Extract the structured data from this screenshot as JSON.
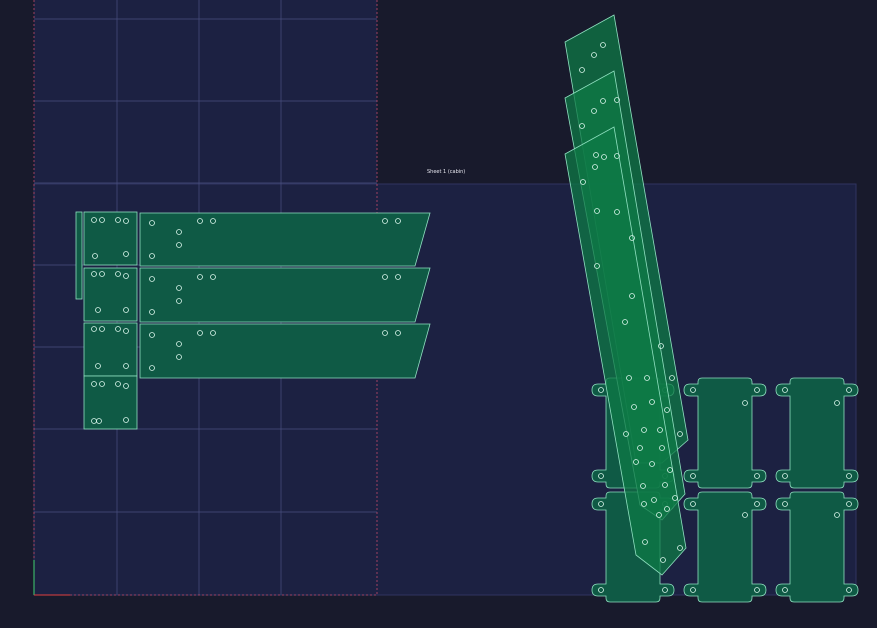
{
  "sheet": {
    "label": "Sheet 1 (cabin)"
  },
  "colors": {
    "background": "#181a2c",
    "sheet_fill": "#1c2142",
    "grid_line": "#4a5080",
    "sheet_border_dashed": "#c04a6a",
    "part_fill": "#0f5a45",
    "part_fill_highlight": "#0d7a45",
    "part_stroke": "#8fe0c0",
    "hole_stroke": "#d8f4ea"
  },
  "parts": {
    "plates_count": 4,
    "slats_count": 3,
    "tilted_legs_count": 3,
    "frames_count": 6
  }
}
